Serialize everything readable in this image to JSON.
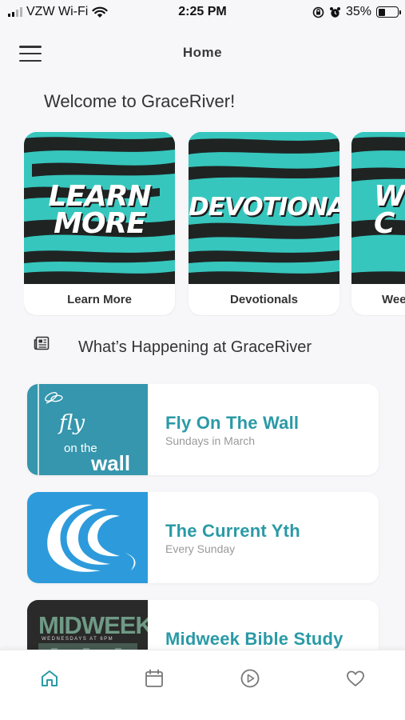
{
  "status_bar": {
    "carrier": "VZW Wi-Fi",
    "time": "2:25 PM",
    "battery_text": "35%",
    "battery_level": 0.35
  },
  "header": {
    "title": "Home",
    "menu_icon": "hamburger-menu-icon"
  },
  "welcome": "Welcome to GraceRiver!",
  "quick_links": [
    {
      "label": "Learn More",
      "art_lines": [
        "LEARN",
        "MORE"
      ]
    },
    {
      "label": "Devotionals",
      "art_lines": [
        "DEVOTIONALS"
      ]
    },
    {
      "label": "Wee",
      "art_lines": [
        "W",
        "C"
      ]
    }
  ],
  "section": {
    "title": "What’s Happening at GraceRiver",
    "icon": "newspaper-icon"
  },
  "events": [
    {
      "title": "Fly On The Wall",
      "subtitle": "Sundays in March",
      "art": [
        "fly",
        "on the",
        "wall"
      ]
    },
    {
      "title": "The Current Yth",
      "subtitle": "Every Sunday"
    },
    {
      "title": "Midweek Bible Study",
      "subtitle": "",
      "art": [
        "MIDWEEK",
        "WEDNESDAYS AT 6PM"
      ]
    }
  ],
  "tab_bar": {
    "tabs": [
      "home-icon",
      "calendar-icon",
      "play-icon",
      "heart-icon"
    ],
    "active": "home-icon"
  },
  "colors": {
    "accent": "#2a9aa6",
    "teal_art": "#36c6bd",
    "current_blue": "#2d9bdb",
    "fly_teal": "#3596ad"
  }
}
